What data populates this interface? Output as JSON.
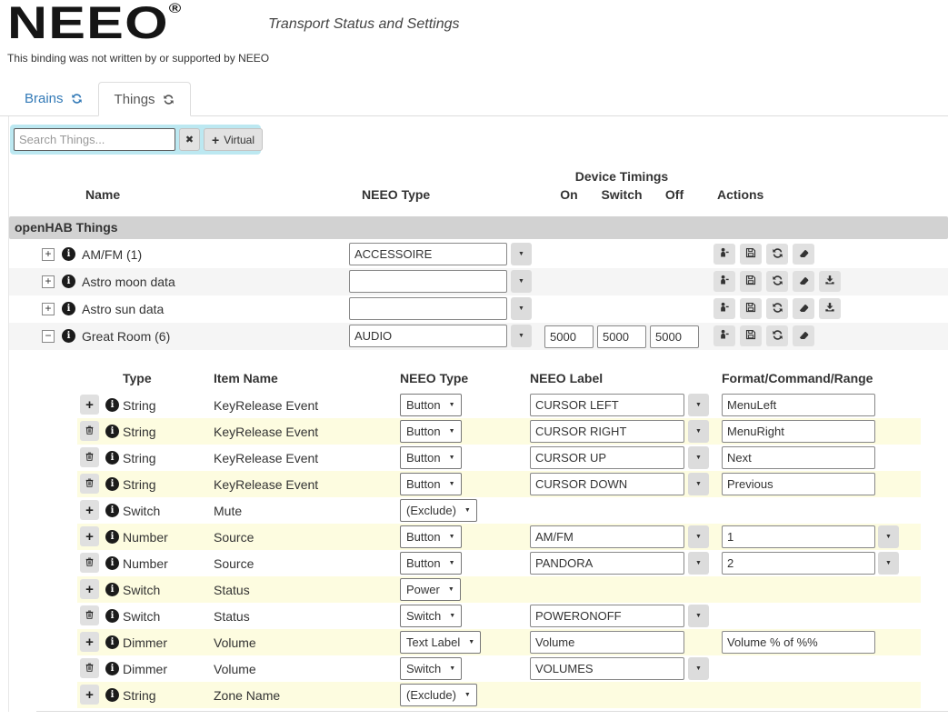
{
  "header": {
    "logo": "NEEO",
    "registered": "®",
    "subtitle": "Transport Status and Settings",
    "disclaimer": "This binding was not written by or supported by NEEO"
  },
  "tabs": [
    {
      "label": "Brains",
      "icon": "refresh-icon",
      "active": false
    },
    {
      "label": "Things",
      "icon": "refresh-icon",
      "active": true
    }
  ],
  "search": {
    "placeholder": "Search Things...",
    "value": "",
    "clear_icon": "x-icon",
    "virtual_label": "Virtual",
    "virtual_icon": "plus-icon"
  },
  "things_table": {
    "device_timings_label": "Device Timings",
    "columns": {
      "name": "Name",
      "neeo_type": "NEEO Type",
      "on": "On",
      "switch": "Switch",
      "off": "Off",
      "actions": "Actions"
    },
    "group_header": "openHAB Things",
    "rows": [
      {
        "expanded": false,
        "name": "AM/FM (1)",
        "neeo_type": "ACCESSOIRE",
        "timings": null,
        "actions": [
          "hydrant-icon",
          "save-icon",
          "refresh-icon",
          "eraser-icon"
        ]
      },
      {
        "expanded": false,
        "name": "Astro moon data",
        "neeo_type": "",
        "timings": null,
        "actions": [
          "hydrant-icon",
          "save-icon",
          "refresh-icon",
          "eraser-icon",
          "download-icon"
        ]
      },
      {
        "expanded": false,
        "name": "Astro sun data",
        "neeo_type": "",
        "timings": null,
        "actions": [
          "hydrant-icon",
          "save-icon",
          "refresh-icon",
          "eraser-icon",
          "download-icon"
        ]
      },
      {
        "expanded": true,
        "name": "Great Room (6)",
        "neeo_type": "AUDIO",
        "timings": {
          "on": "5000",
          "switch": "5000",
          "off": "5000"
        },
        "actions": [
          "hydrant-icon",
          "save-icon",
          "refresh-icon",
          "eraser-icon"
        ]
      }
    ]
  },
  "channels_table": {
    "columns": {
      "type": "Type",
      "item_name": "Item Name",
      "neeo_type": "NEEO Type",
      "neeo_label": "NEEO Label",
      "format": "Format/Command/Range"
    },
    "rows": [
      {
        "action": "add",
        "type": "String",
        "item_name": "KeyRelease Event",
        "neeo_type": "Button",
        "neeo_label": "CURSOR LEFT",
        "label_dropdown": true,
        "format": "MenuLeft",
        "format_dropdown": false
      },
      {
        "action": "delete",
        "type": "String",
        "item_name": "KeyRelease Event",
        "neeo_type": "Button",
        "neeo_label": "CURSOR RIGHT",
        "label_dropdown": true,
        "format": "MenuRight",
        "format_dropdown": false
      },
      {
        "action": "delete",
        "type": "String",
        "item_name": "KeyRelease Event",
        "neeo_type": "Button",
        "neeo_label": "CURSOR UP",
        "label_dropdown": true,
        "format": "Next",
        "format_dropdown": false
      },
      {
        "action": "delete",
        "type": "String",
        "item_name": "KeyRelease Event",
        "neeo_type": "Button",
        "neeo_label": "CURSOR DOWN",
        "label_dropdown": true,
        "format": "Previous",
        "format_dropdown": false
      },
      {
        "action": "add",
        "type": "Switch",
        "item_name": "Mute",
        "neeo_type": "(Exclude)",
        "neeo_label": null,
        "label_dropdown": false,
        "format": null,
        "format_dropdown": false
      },
      {
        "action": "add",
        "type": "Number",
        "item_name": "Source",
        "neeo_type": "Button",
        "neeo_label": "AM/FM",
        "label_dropdown": true,
        "format": "1",
        "format_dropdown": true
      },
      {
        "action": "delete",
        "type": "Number",
        "item_name": "Source",
        "neeo_type": "Button",
        "neeo_label": "PANDORA",
        "label_dropdown": true,
        "format": "2",
        "format_dropdown": true
      },
      {
        "action": "add",
        "type": "Switch",
        "item_name": "Status",
        "neeo_type": "Power",
        "neeo_label": null,
        "label_dropdown": false,
        "format": null,
        "format_dropdown": false
      },
      {
        "action": "delete",
        "type": "Switch",
        "item_name": "Status",
        "neeo_type": "Switch",
        "neeo_label": "POWERONOFF",
        "label_dropdown": true,
        "format": null,
        "format_dropdown": false
      },
      {
        "action": "add",
        "type": "Dimmer",
        "item_name": "Volume",
        "neeo_type": "Text Label",
        "neeo_label": "Volume",
        "label_dropdown": false,
        "format": "Volume % of %%",
        "format_dropdown": false
      },
      {
        "action": "delete",
        "type": "Dimmer",
        "item_name": "Volume",
        "neeo_type": "Switch",
        "neeo_label": "VOLUMES",
        "label_dropdown": true,
        "format": null,
        "format_dropdown": false
      },
      {
        "action": "add",
        "type": "String",
        "item_name": "Zone Name",
        "neeo_type": "(Exclude)",
        "neeo_label": null,
        "label_dropdown": false,
        "format": null,
        "format_dropdown": false
      }
    ]
  },
  "colors": {
    "accent_blue": "#337ab7",
    "search_panel_blue": "#bce8f1",
    "group_header_gray": "#d2d2d2",
    "row_stripe_gray": "#f5f5f5",
    "row_stripe_yellow": "#fdfce0"
  }
}
